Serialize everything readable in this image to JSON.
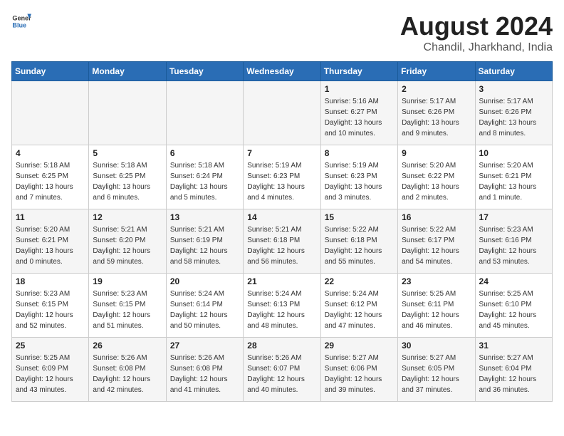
{
  "header": {
    "logo_general": "General",
    "logo_blue": "Blue",
    "title": "August 2024",
    "location": "Chandil, Jharkhand, India"
  },
  "days_of_week": [
    "Sunday",
    "Monday",
    "Tuesday",
    "Wednesday",
    "Thursday",
    "Friday",
    "Saturday"
  ],
  "weeks": [
    [
      {
        "day": "",
        "info": ""
      },
      {
        "day": "",
        "info": ""
      },
      {
        "day": "",
        "info": ""
      },
      {
        "day": "",
        "info": ""
      },
      {
        "day": "1",
        "info": "Sunrise: 5:16 AM\nSunset: 6:27 PM\nDaylight: 13 hours\nand 10 minutes."
      },
      {
        "day": "2",
        "info": "Sunrise: 5:17 AM\nSunset: 6:26 PM\nDaylight: 13 hours\nand 9 minutes."
      },
      {
        "day": "3",
        "info": "Sunrise: 5:17 AM\nSunset: 6:26 PM\nDaylight: 13 hours\nand 8 minutes."
      }
    ],
    [
      {
        "day": "4",
        "info": "Sunrise: 5:18 AM\nSunset: 6:25 PM\nDaylight: 13 hours\nand 7 minutes."
      },
      {
        "day": "5",
        "info": "Sunrise: 5:18 AM\nSunset: 6:25 PM\nDaylight: 13 hours\nand 6 minutes."
      },
      {
        "day": "6",
        "info": "Sunrise: 5:18 AM\nSunset: 6:24 PM\nDaylight: 13 hours\nand 5 minutes."
      },
      {
        "day": "7",
        "info": "Sunrise: 5:19 AM\nSunset: 6:23 PM\nDaylight: 13 hours\nand 4 minutes."
      },
      {
        "day": "8",
        "info": "Sunrise: 5:19 AM\nSunset: 6:23 PM\nDaylight: 13 hours\nand 3 minutes."
      },
      {
        "day": "9",
        "info": "Sunrise: 5:20 AM\nSunset: 6:22 PM\nDaylight: 13 hours\nand 2 minutes."
      },
      {
        "day": "10",
        "info": "Sunrise: 5:20 AM\nSunset: 6:21 PM\nDaylight: 13 hours\nand 1 minute."
      }
    ],
    [
      {
        "day": "11",
        "info": "Sunrise: 5:20 AM\nSunset: 6:21 PM\nDaylight: 13 hours\nand 0 minutes."
      },
      {
        "day": "12",
        "info": "Sunrise: 5:21 AM\nSunset: 6:20 PM\nDaylight: 12 hours\nand 59 minutes."
      },
      {
        "day": "13",
        "info": "Sunrise: 5:21 AM\nSunset: 6:19 PM\nDaylight: 12 hours\nand 58 minutes."
      },
      {
        "day": "14",
        "info": "Sunrise: 5:21 AM\nSunset: 6:18 PM\nDaylight: 12 hours\nand 56 minutes."
      },
      {
        "day": "15",
        "info": "Sunrise: 5:22 AM\nSunset: 6:18 PM\nDaylight: 12 hours\nand 55 minutes."
      },
      {
        "day": "16",
        "info": "Sunrise: 5:22 AM\nSunset: 6:17 PM\nDaylight: 12 hours\nand 54 minutes."
      },
      {
        "day": "17",
        "info": "Sunrise: 5:23 AM\nSunset: 6:16 PM\nDaylight: 12 hours\nand 53 minutes."
      }
    ],
    [
      {
        "day": "18",
        "info": "Sunrise: 5:23 AM\nSunset: 6:15 PM\nDaylight: 12 hours\nand 52 minutes."
      },
      {
        "day": "19",
        "info": "Sunrise: 5:23 AM\nSunset: 6:15 PM\nDaylight: 12 hours\nand 51 minutes."
      },
      {
        "day": "20",
        "info": "Sunrise: 5:24 AM\nSunset: 6:14 PM\nDaylight: 12 hours\nand 50 minutes."
      },
      {
        "day": "21",
        "info": "Sunrise: 5:24 AM\nSunset: 6:13 PM\nDaylight: 12 hours\nand 48 minutes."
      },
      {
        "day": "22",
        "info": "Sunrise: 5:24 AM\nSunset: 6:12 PM\nDaylight: 12 hours\nand 47 minutes."
      },
      {
        "day": "23",
        "info": "Sunrise: 5:25 AM\nSunset: 6:11 PM\nDaylight: 12 hours\nand 46 minutes."
      },
      {
        "day": "24",
        "info": "Sunrise: 5:25 AM\nSunset: 6:10 PM\nDaylight: 12 hours\nand 45 minutes."
      }
    ],
    [
      {
        "day": "25",
        "info": "Sunrise: 5:25 AM\nSunset: 6:09 PM\nDaylight: 12 hours\nand 43 minutes."
      },
      {
        "day": "26",
        "info": "Sunrise: 5:26 AM\nSunset: 6:08 PM\nDaylight: 12 hours\nand 42 minutes."
      },
      {
        "day": "27",
        "info": "Sunrise: 5:26 AM\nSunset: 6:08 PM\nDaylight: 12 hours\nand 41 minutes."
      },
      {
        "day": "28",
        "info": "Sunrise: 5:26 AM\nSunset: 6:07 PM\nDaylight: 12 hours\nand 40 minutes."
      },
      {
        "day": "29",
        "info": "Sunrise: 5:27 AM\nSunset: 6:06 PM\nDaylight: 12 hours\nand 39 minutes."
      },
      {
        "day": "30",
        "info": "Sunrise: 5:27 AM\nSunset: 6:05 PM\nDaylight: 12 hours\nand 37 minutes."
      },
      {
        "day": "31",
        "info": "Sunrise: 5:27 AM\nSunset: 6:04 PM\nDaylight: 12 hours\nand 36 minutes."
      }
    ]
  ]
}
